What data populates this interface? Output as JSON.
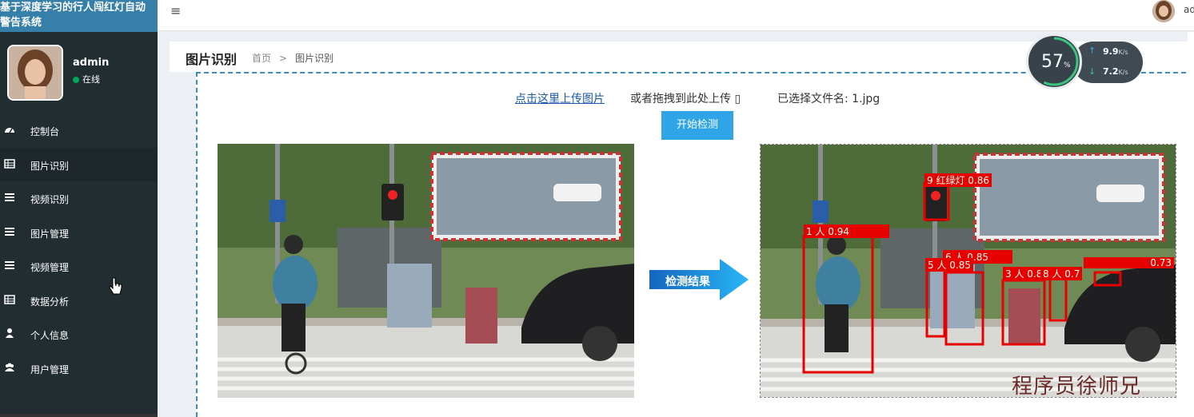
{
  "app": {
    "title": "基于深度学习的行人闯红灯自动警告系统"
  },
  "user": {
    "name": "admin",
    "status": "在线",
    "header_name": "adı"
  },
  "sidebar": {
    "items": [
      {
        "label": "控制台",
        "icon": "dashboard-icon"
      },
      {
        "label": "图片识别",
        "icon": "table-icon",
        "active": true
      },
      {
        "label": "视频识别",
        "icon": "list-icon"
      },
      {
        "label": "图片管理",
        "icon": "list-icon"
      },
      {
        "label": "视频管理",
        "icon": "list-icon"
      },
      {
        "label": "数据分析",
        "icon": "table-icon"
      },
      {
        "label": "个人信息",
        "icon": "user-icon"
      },
      {
        "label": "用户管理",
        "icon": "users-icon"
      }
    ]
  },
  "page": {
    "title": "图片识别",
    "breadcrumb": [
      "首页",
      "图片识别"
    ],
    "breadcrumb_sep": ">"
  },
  "upload": {
    "link_text": "点击这里上传图片",
    "drag_text": "或者拖拽到此处上传 ▯",
    "file_selected": "已选择文件名: 1.jpg",
    "start_button": "开始检测"
  },
  "result": {
    "arrow_label": "检测结果",
    "detections": [
      {
        "label": "9 红绿灯 0.86"
      },
      {
        "label": "1 人 0.94"
      },
      {
        "label": "6 人 0.85"
      },
      {
        "label": "5 人 0.85"
      },
      {
        "label": "3 人 0.8"
      },
      {
        "label": "8 人 0.7"
      },
      {
        "label": "0.73"
      }
    ]
  },
  "speed_widget": {
    "percent": "57",
    "percent_unit": "%",
    "upload": "9.9",
    "download": "7.2",
    "unit": "K/s"
  },
  "watermark": "程序员徐师兄",
  "colors": {
    "sidebar": "#222d32",
    "brand": "#367fa9",
    "accent": "#2fa4e7",
    "detection": "#e60000"
  }
}
